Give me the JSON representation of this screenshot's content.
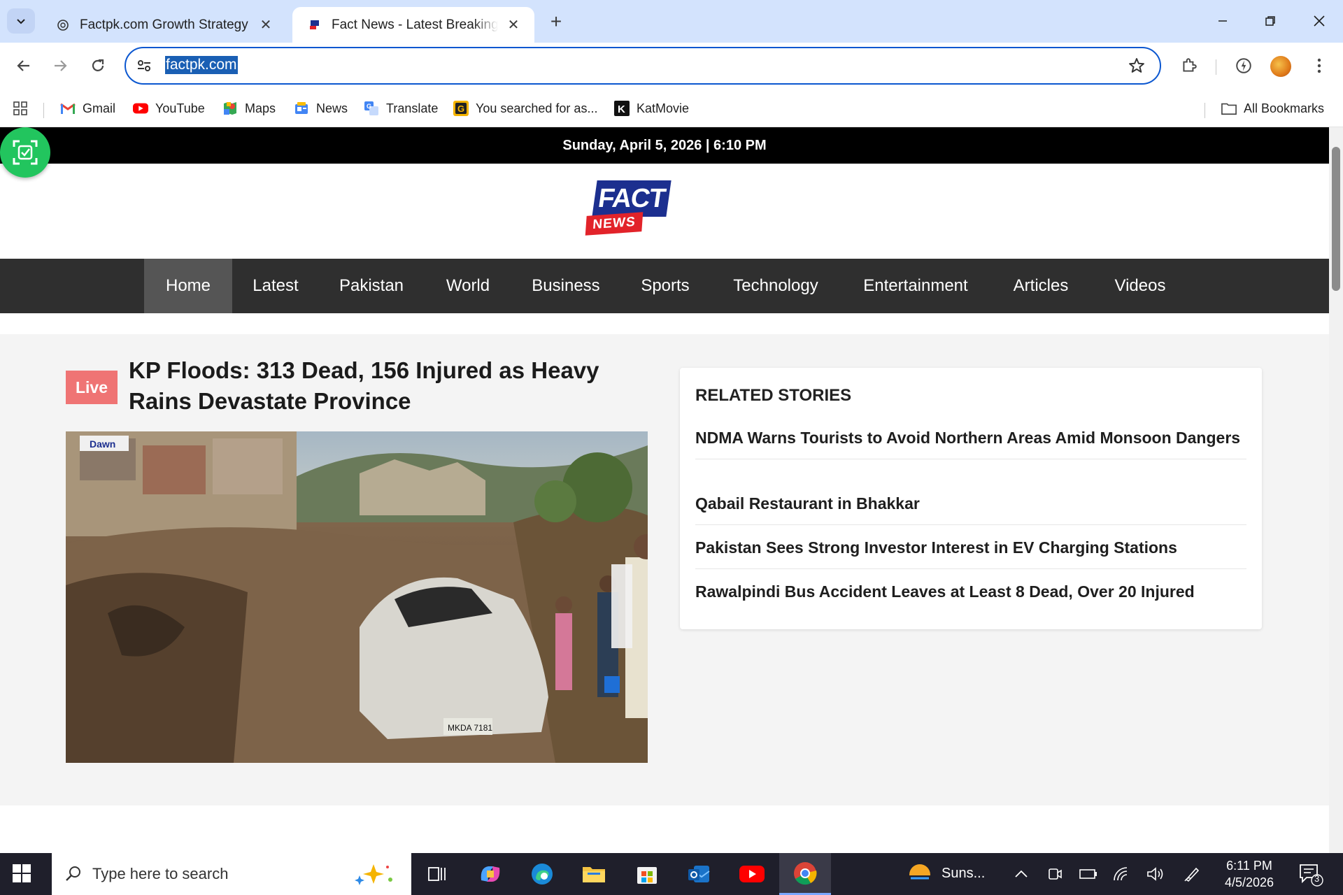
{
  "browser": {
    "tabs": [
      {
        "title": "Factpk.com Growth Strategy",
        "active": false
      },
      {
        "title": "Fact News - Latest Breaking News",
        "active": true
      }
    ],
    "url": "factpk.com",
    "bookmarks": [
      {
        "label": "Gmail",
        "icon": "gmail-icon"
      },
      {
        "label": "YouTube",
        "icon": "youtube-icon"
      },
      {
        "label": "Maps",
        "icon": "maps-icon"
      },
      {
        "label": "News",
        "icon": "news-icon"
      },
      {
        "label": "Translate",
        "icon": "translate-icon"
      },
      {
        "label": "You searched for as...",
        "icon": "g-icon"
      },
      {
        "label": "KatMovie",
        "icon": "k-icon"
      }
    ],
    "all_bookmarks": "All Bookmarks"
  },
  "site": {
    "date_line": "Sunday, April 5, 2026 | 6:10 PM",
    "logo_top": "FACT",
    "logo_bottom": "NEWS",
    "nav": [
      "Home",
      "Latest",
      "Pakistan",
      "World",
      "Business",
      "Sports",
      "Technology",
      "Entertainment",
      "Articles",
      "Videos"
    ],
    "active_nav": "Home",
    "featured": {
      "badge": "Live",
      "headline": "KP Floods: 313 Dead, 156 Injured as Heavy Rains Devastate Province",
      "image_caption_sign": "Dawn",
      "plate": "MKDA 7181"
    },
    "related": {
      "title": "RELATED STORIES",
      "stories": [
        "NDMA Warns Tourists to Avoid Northern Areas Amid Monsoon Dangers",
        "Qabail Restaurant in Bhakkar",
        "Pakistan Sees Strong Investor Interest in EV Charging Stations",
        "Rawalpindi Bus Accident Leaves at Least 8 Dead, Over 20 Injured"
      ]
    }
  },
  "taskbar": {
    "search_placeholder": "Type here to search",
    "weather": "Suns...",
    "time": "6:11 PM",
    "date": "4/5/2026",
    "notifications": "3"
  },
  "colors": {
    "accent": "#0b57d0",
    "tabstrip": "#d3e3fd",
    "nav_bg": "#2f2f2f",
    "live": "#ef7474"
  }
}
